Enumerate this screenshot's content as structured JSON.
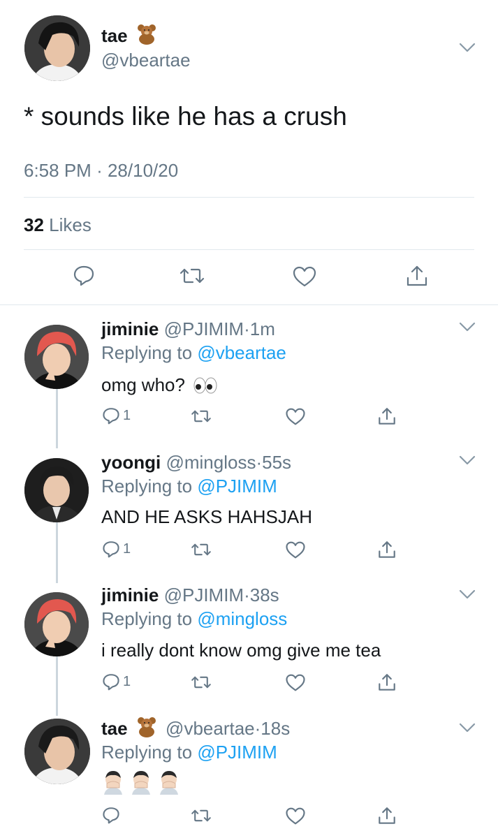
{
  "main_tweet": {
    "name": "tae",
    "handle": "@vbeartae",
    "text": "* sounds like he has a crush",
    "time": "6:58 PM",
    "date": "28/10/20",
    "likes_count": "32",
    "likes_label": "Likes"
  },
  "replies": [
    {
      "name": "jiminie",
      "handle": "@PJIMIM",
      "age": "1m",
      "replying_label": "Replying to",
      "replying_to": "@vbeartae",
      "text": "omg who?",
      "reply_count": "1",
      "avatar_hair": "#e2584f"
    },
    {
      "name": "yoongi",
      "handle": "@mingloss",
      "age": "55s",
      "replying_label": "Replying to",
      "replying_to": "@PJIMIM",
      "text": "AND HE ASKS HAHSJAH",
      "reply_count": "1",
      "avatar_hair": "#1c1c1c"
    },
    {
      "name": "jiminie",
      "handle": "@PJIMIM",
      "age": "38s",
      "replying_label": "Replying to",
      "replying_to": "@mingloss",
      "text": "i really dont know omg give me tea",
      "reply_count": "1",
      "avatar_hair": "#e2584f"
    },
    {
      "name": "tae",
      "handle": "@vbeartae",
      "age": "18s",
      "replying_label": "Replying to",
      "replying_to": "@PJIMIM",
      "text": "",
      "reply_count": "",
      "avatar_hair": "#1a1a1a"
    }
  ],
  "colors": {
    "link": "#1da1f2",
    "secondary_text": "#657786",
    "divider": "#e1e8ed"
  },
  "icons": [
    "teddy-bear-emoji",
    "eyes-emoji",
    "face-palm-emoji",
    "reply-icon",
    "retweet-icon",
    "like-icon",
    "share-icon",
    "chevron-down-icon"
  ]
}
